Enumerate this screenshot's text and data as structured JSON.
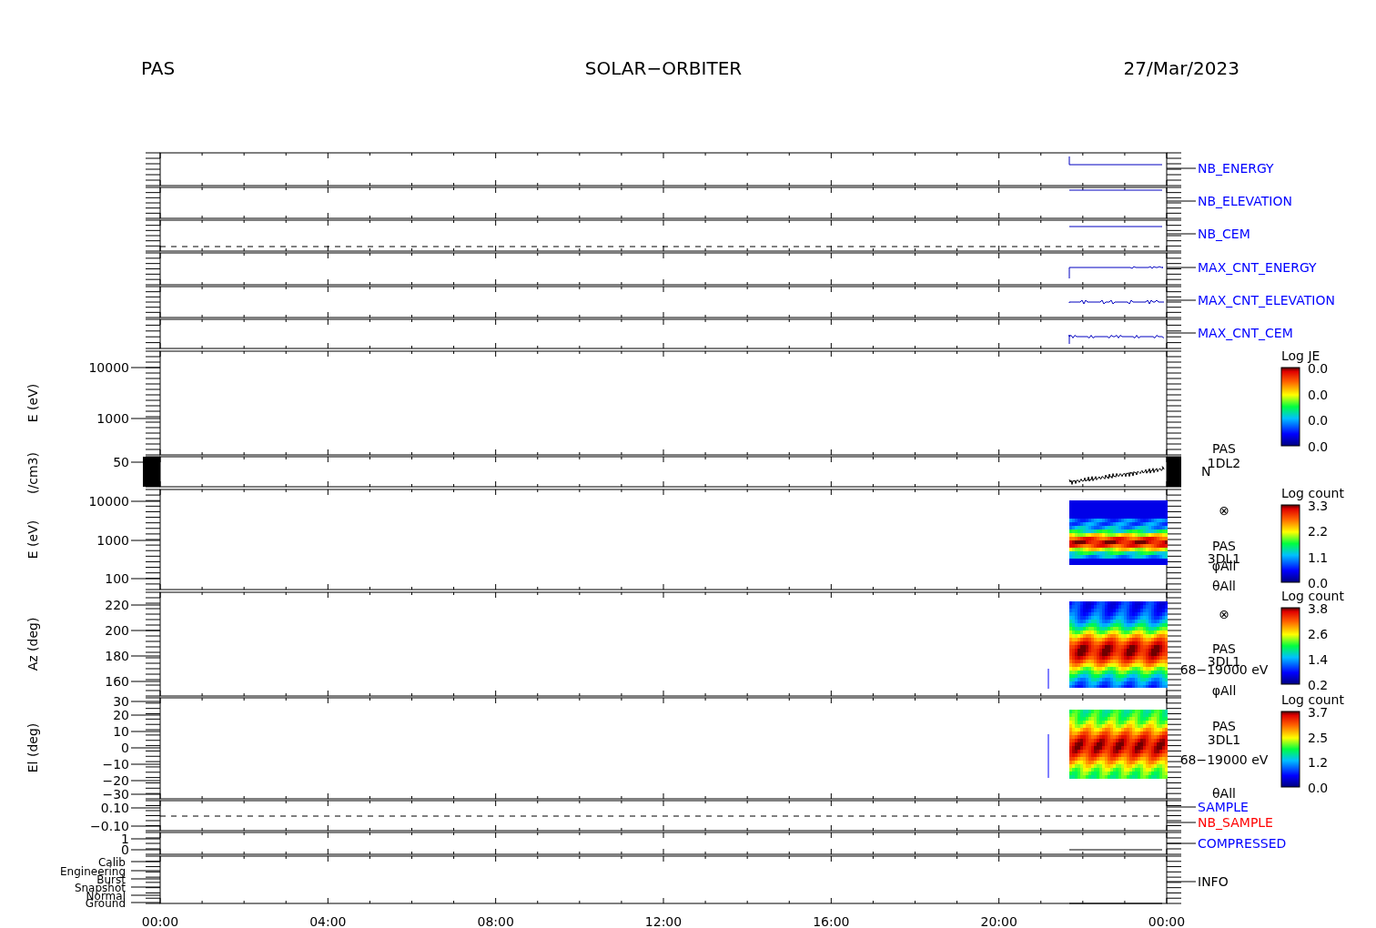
{
  "header": {
    "instrument": "PAS",
    "mission": "SOLAR−ORBITER",
    "date": "27/Mar/2023"
  },
  "time_axis": {
    "ticks": [
      "00:00",
      "04:00",
      "08:00",
      "12:00",
      "16:00",
      "20:00",
      "00:00"
    ]
  },
  "panels": [
    {
      "kind": "line",
      "labels": [
        {
          "text": "NB_ENERGY",
          "color": "#0000ff"
        }
      ]
    },
    {
      "kind": "line",
      "labels": [
        {
          "text": "NB_ELEVATION",
          "color": "#0000ff"
        }
      ]
    },
    {
      "kind": "line",
      "labels": [
        {
          "text": "NB_CEM",
          "color": "#0000ff"
        }
      ]
    },
    {
      "kind": "line",
      "labels": [
        {
          "text": "MAX_CNT_ENERGY",
          "color": "#0000ff"
        }
      ]
    },
    {
      "kind": "line",
      "labels": [
        {
          "text": "MAX_CNT_ELEVATION",
          "color": "#0000ff"
        }
      ]
    },
    {
      "kind": "line",
      "labels": [
        {
          "text": "MAX_CNT_CEM",
          "color": "#0000ff"
        }
      ]
    },
    {
      "kind": "spectrogram",
      "ylabel": "E (eV)",
      "yticks": [
        "10000",
        "1000"
      ],
      "colorbar": {
        "title": "Log JE",
        "ticks": [
          "0.0",
          "0.0",
          "0.0",
          "0.0"
        ]
      }
    },
    {
      "kind": "density",
      "ylabel": "(/cm3)",
      "yticks": [
        "50"
      ],
      "side_text": [
        "PAS",
        "1DL2",
        "N"
      ]
    },
    {
      "kind": "spectrogram",
      "ylabel": "E (eV)",
      "yticks": [
        "10000",
        "1000",
        "100"
      ],
      "side_text": [
        "⊗",
        "PAS",
        "3DL1",
        "φAll",
        "θAll"
      ],
      "colorbar": {
        "title": "Log count",
        "ticks": [
          "3.3",
          "2.2",
          "1.1",
          "0.0"
        ]
      }
    },
    {
      "kind": "spectrogram",
      "ylabel": "Az (deg)",
      "yticks": [
        "220",
        "200",
        "180",
        "160"
      ],
      "side_text": [
        "⊗",
        "PAS",
        "3DL1",
        "68−19000 eV",
        "φAll"
      ],
      "colorbar": {
        "title": "Log count",
        "ticks": [
          "3.8",
          "2.6",
          "1.4",
          "0.2"
        ]
      }
    },
    {
      "kind": "spectrogram",
      "ylabel": "El (deg)",
      "yticks": [
        "30",
        "20",
        "10",
        "0",
        "−10",
        "−20",
        "−30"
      ],
      "side_text": [
        "PAS",
        "3DL1",
        "68−19000 eV",
        "θAll"
      ],
      "colorbar": {
        "title": "Log count",
        "ticks": [
          "3.7",
          "2.5",
          "1.2",
          "0.0"
        ]
      }
    },
    {
      "kind": "line",
      "yticks": [
        "0.10",
        "−0.10"
      ],
      "labels": [
        {
          "text": "SAMPLE",
          "color": "#0000ff"
        },
        {
          "text": "NB_SAMPLE",
          "color": "#ff0000"
        }
      ]
    },
    {
      "kind": "line",
      "yticks": [
        "1",
        "0"
      ],
      "labels": [
        {
          "text": "COMPRESSED",
          "color": "#0000ff"
        }
      ]
    },
    {
      "kind": "status",
      "yticks": [
        "Calib",
        "Engineering",
        "Burst",
        "Snapshot",
        "Normal",
        "Ground"
      ],
      "labels": [
        {
          "text": "INFO",
          "color": "#000000"
        }
      ]
    }
  ]
}
